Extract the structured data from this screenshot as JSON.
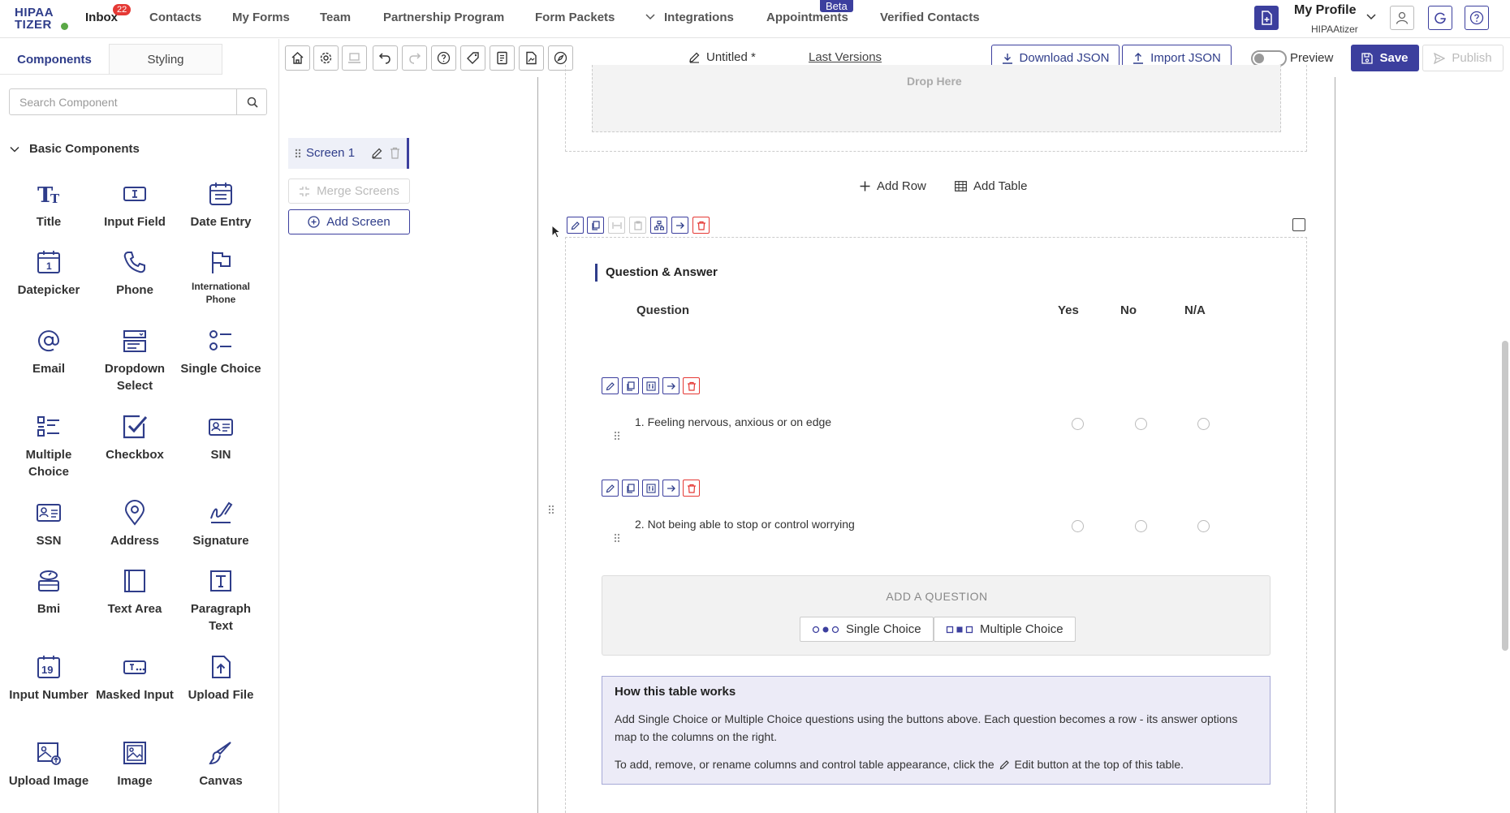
{
  "nav": {
    "logo_line1": "HIPAA",
    "logo_line2": "TIZER",
    "inbox": "Inbox",
    "inbox_count": "22",
    "contacts": "Contacts",
    "my_forms": "My Forms",
    "team": "Team",
    "partnership": "Partnership Program",
    "form_packets": "Form Packets",
    "integrations": "Integrations",
    "appointments": "Appointments",
    "appointments_badge": "Beta",
    "verified_contacts": "Verified Contacts",
    "profile_name": "My Profile",
    "profile_org": "HIPAAtizer"
  },
  "left_panel": {
    "tab_components": "Components",
    "tab_styling": "Styling",
    "search_placeholder": "Search Component",
    "section_title": "Basic Components",
    "components": [
      {
        "label": "Title",
        "icon": "title-icon"
      },
      {
        "label": "Input Field",
        "icon": "input-field-icon"
      },
      {
        "label": "Date Entry",
        "icon": "date-entry-icon"
      },
      {
        "label": "Datepicker",
        "icon": "datepicker-icon",
        "icon_text": "1"
      },
      {
        "label": "Phone",
        "icon": "phone-icon"
      },
      {
        "label": "International Phone",
        "icon": "flag-icon"
      },
      {
        "label": "Email",
        "icon": "at-icon"
      },
      {
        "label": "Dropdown Select",
        "icon": "dropdown-icon"
      },
      {
        "label": "Single Choice",
        "icon": "single-choice-icon"
      },
      {
        "label": "Multiple Choice",
        "icon": "multiple-choice-icon"
      },
      {
        "label": "Checkbox",
        "icon": "checkbox-icon"
      },
      {
        "label": "SIN",
        "icon": "sin-card-icon"
      },
      {
        "label": "SSN",
        "icon": "ssn-card-icon"
      },
      {
        "label": "Address",
        "icon": "location-pin-icon"
      },
      {
        "label": "Signature",
        "icon": "signature-icon"
      },
      {
        "label": "Bmi",
        "icon": "scale-icon"
      },
      {
        "label": "Text Area",
        "icon": "text-area-icon"
      },
      {
        "label": "Paragraph Text",
        "icon": "paragraph-icon"
      },
      {
        "label": "Input Number",
        "icon": "input-number-icon",
        "icon_text": "19"
      },
      {
        "label": "Masked Input",
        "icon": "masked-input-icon"
      },
      {
        "label": "Upload File",
        "icon": "upload-file-icon"
      },
      {
        "label": "Upload Image",
        "icon": "upload-image-icon"
      },
      {
        "label": "Image",
        "icon": "image-icon"
      },
      {
        "label": "Canvas",
        "icon": "brush-icon"
      }
    ]
  },
  "screens": {
    "screen_1": "Screen 1",
    "merge": "Merge Screens",
    "add": "Add Screen"
  },
  "toolbar": {
    "doc_title": "Untitled *",
    "last_versions": "Last Versions",
    "download_json": "Download JSON",
    "import_json": "Import JSON",
    "preview": "Preview",
    "save": "Save",
    "publish": "Publish"
  },
  "canvas": {
    "drop_here": "Drop Here",
    "add_row": "Add Row",
    "add_table": "Add Table",
    "table_title": "Question & Answer",
    "columns": [
      "Question",
      "Yes",
      "No",
      "N/A"
    ],
    "questions": [
      "1. Feeling nervous, anxious or on edge",
      "2. Not being able to stop or control worrying"
    ],
    "add_question_label": "ADD A QUESTION",
    "single_choice_btn": "Single Choice",
    "multiple_choice_btn": "Multiple Choice",
    "how_title": "How this table works",
    "how_p1": "Add Single Choice or Multiple Choice questions using the buttons above. Each question becomes a row - its answer options map to the columns on the right.",
    "how_p2_before": "To add, remove, or rename columns and control table appearance, click the",
    "how_p2_after": "Edit button at the top of this table."
  },
  "colors": {
    "brand": "#3c3f9e",
    "danger": "#e53935",
    "logo_dot": "#5aa846",
    "info_bg": "#ecebf7"
  }
}
